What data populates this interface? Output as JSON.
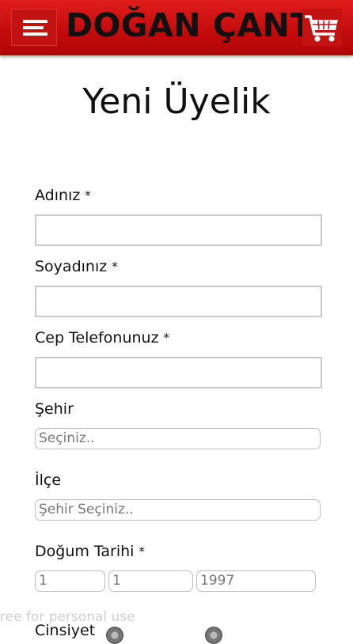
{
  "header": {
    "menu_icon": "hamburger-menu-icon",
    "logo": "DOĞAN ÇANTA",
    "cart_icon": "shopping-cart-icon",
    "background_color": "#c40c0c"
  },
  "page_title": "Yeni Üyelik",
  "form": {
    "first_name": {
      "label": "Adınız",
      "required_mark": "*",
      "value": ""
    },
    "last_name": {
      "label": "Soyadınız",
      "required_mark": "*",
      "value": ""
    },
    "phone": {
      "label": "Cep Telefonunuz",
      "required_mark": "*",
      "value": ""
    },
    "city": {
      "label": "Şehir",
      "selected": "Seçiniz.."
    },
    "district": {
      "label": "İlçe",
      "selected": "Şehir Seçiniz.."
    },
    "birth_date": {
      "label": "Doğum Tarihi",
      "required_mark": "*",
      "day": "1",
      "month": "1",
      "year": "1997"
    },
    "gender_label_partial": "Cinsiyet"
  },
  "watermark": "ree for personal use"
}
